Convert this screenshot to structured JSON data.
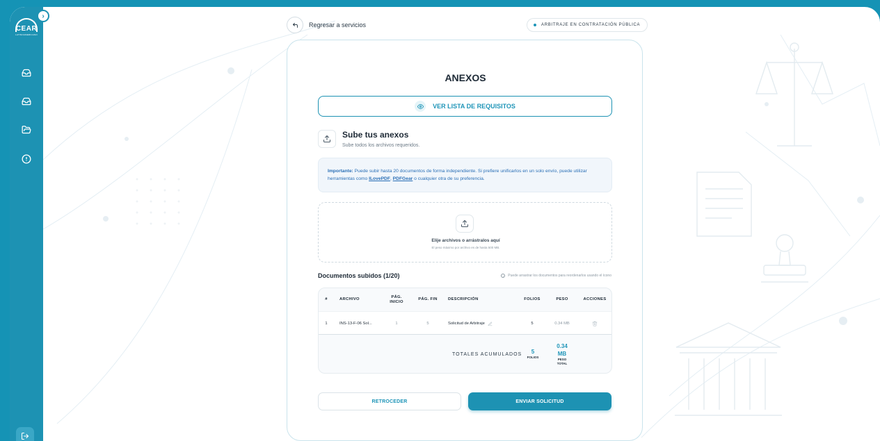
{
  "logo": {
    "text": "CEAR",
    "subtext": "LATINOAMERICANO"
  },
  "nav": {
    "collapse_icon": "chevron-right-icon",
    "items": [
      {
        "icon": "inbox-icon"
      },
      {
        "icon": "inbox-icon"
      },
      {
        "icon": "folder-open-icon"
      },
      {
        "icon": "alert-circle-icon"
      }
    ],
    "logout_icon": "logout-icon"
  },
  "topbar": {
    "back_label": "Regresar a servicios",
    "tag_label": "ARBITRAJE EN CONTRATACIÓN PÚBLICA"
  },
  "card": {
    "title": "ANEXOS",
    "requirements_button": "VER LISTA DE REQUISITOS",
    "upload_title": "Sube tus anexos",
    "upload_subtitle": "Sube todos los archivos requeridos.",
    "notice": {
      "bold": "Importante:",
      "text1": " Puede subir hasta 20 documentos de forma independiente. Si prefiere unificarlos en un solo envío, puede utilizar herramientas como ",
      "link1": "ILovePDF",
      "sep": ", ",
      "link2": "PDFGear",
      "text2": " o cualquier otra de su preferencia."
    },
    "dropzone": {
      "line1": "Elije archivos o arrástralos aquí",
      "line2": "El peso máximo por archivo es de hasta 500 MB."
    },
    "docs_title": "Documentos subidos (1/20)",
    "docs_hint": "Puede arrastrar los documentos para reordenarlos usando el ícono",
    "table": {
      "headers": {
        "num": "#",
        "archivo": "ARCHIVO",
        "pag_inicio": "PÁG. INICIO",
        "pag_fin": "PÁG. FIN",
        "descripcion": "DESCRIPCIÓN",
        "folios": "FOLIOS",
        "peso": "PESO",
        "acciones": "ACCIONES"
      },
      "rows": [
        {
          "num": "1",
          "archivo": "INS-13-F-06 Sol...",
          "pag_inicio": "1",
          "pag_fin": "5",
          "descripcion": "Solicitud de Arbitraje",
          "folios": "5",
          "peso": "0.34 MB"
        }
      ],
      "totals": {
        "label": "TOTALES ACUMULADOS",
        "folios": "5",
        "folios_unit": "FOLIOS",
        "peso_line1": "0.34",
        "peso_line2": "MB",
        "peso_unit_line1": "PESO",
        "peso_unit_line2": "TOTAL"
      }
    },
    "back_button": "RETROCEDER",
    "submit_button": "ENVIAR SOLICITUD"
  },
  "colors": {
    "brand": "#1d92b3",
    "notice_text": "#2a6fb6"
  }
}
